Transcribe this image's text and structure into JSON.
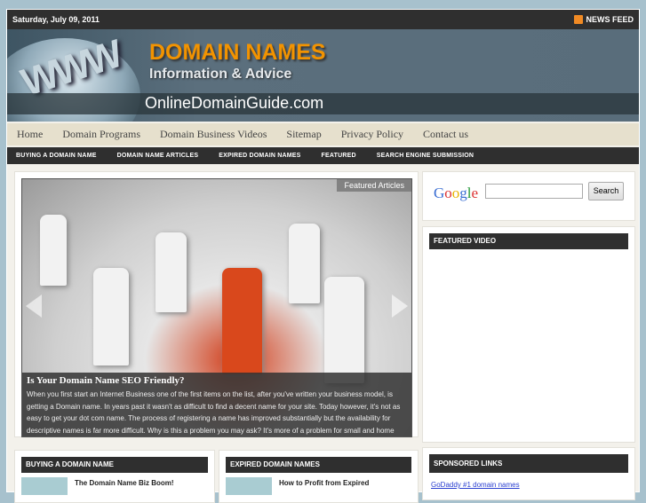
{
  "topbar": {
    "date": "Saturday, July 09, 2011",
    "feed": "NEWS FEED",
    "feed_icon": "rss-icon"
  },
  "header": {
    "title": "DOMAIN NAMES",
    "subtitle": "Information & Advice",
    "site": "OnlineDomainGuide.com",
    "logo_text": "WWW"
  },
  "nav": [
    "Home",
    "Domain Programs",
    "Domain Business Videos",
    "Sitemap",
    "Privacy Policy",
    "Contact us"
  ],
  "subnav": [
    "BUYING A DOMAIN NAME",
    "DOMAIN NAME ARTICLES",
    "EXPIRED DOMAIN NAMES",
    "FEATURED",
    "SEARCH ENGINE SUBMISSION"
  ],
  "slider": {
    "tag": "Featured Articles",
    "title": "Is Your Domain Name SEO Friendly?",
    "text": "When you first start an Internet Business one of the first items on the list, after you've written your business model, is getting a Domain name. In years past it wasn't as difficult to find a decent name for your site. Today however, it's not as easy to get your dot com name. The process of registering a name has improved substantially but the availability for descriptive names is far more difficult. Why is this a problem you may ask? It's more of a problem for small and home"
  },
  "search": {
    "logo": "Google",
    "button": "Search",
    "value": ""
  },
  "widgets": {
    "video": "FEATURED VIDEO",
    "sponsored": "SPONSORED LINKS",
    "sponsored_link": "GoDaddy #1 domain names"
  },
  "sections": [
    {
      "title": "BUYING A DOMAIN NAME",
      "post": "The Domain Name Biz Boom!"
    },
    {
      "title": "EXPIRED DOMAIN NAMES",
      "post": "How to Profit from Expired"
    }
  ],
  "colors": {
    "accent": "#f29300",
    "dark_bar": "#2f2f2f",
    "nav_bg": "#e6e0cd",
    "page_bg": "#a7c1cd"
  }
}
